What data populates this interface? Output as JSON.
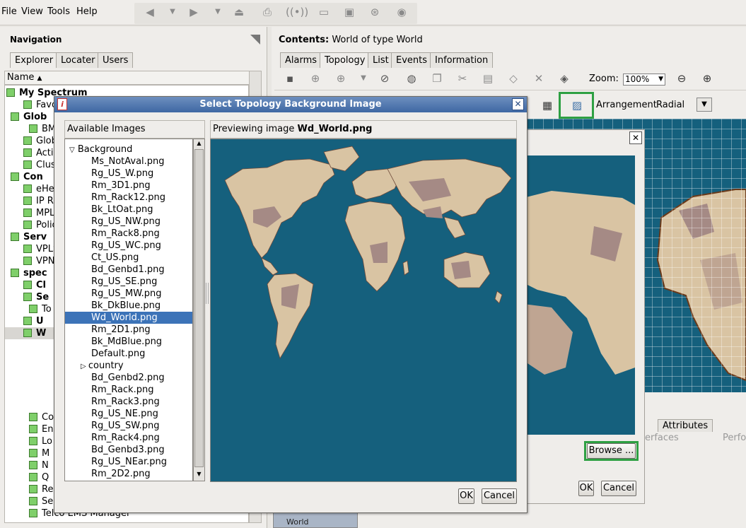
{
  "menubar": {
    "file": "File",
    "view": "View",
    "tools": "Tools",
    "help": "Help"
  },
  "nav": {
    "title": "Navigation",
    "tabs": [
      "Explorer",
      "Locater",
      "Users"
    ],
    "tree_header": "Name",
    "tree": [
      {
        "label": "My Spectrum",
        "bold": true
      },
      {
        "label": "Favo"
      },
      {
        "label": "Glob",
        "bold": true
      },
      {
        "label": "BM"
      },
      {
        "label": "Glob"
      },
      {
        "label": "Activ"
      },
      {
        "label": "Clust"
      },
      {
        "label": "Con",
        "bold": true
      },
      {
        "label": "eHea"
      },
      {
        "label": "IP Ro"
      },
      {
        "label": "MPLS"
      },
      {
        "label": "Polic"
      },
      {
        "label": "Serv",
        "bold": true
      },
      {
        "label": "VPLS"
      },
      {
        "label": "VPN"
      },
      {
        "label": "spec",
        "bold": true
      },
      {
        "label": "Cl",
        "bold": true
      },
      {
        "label": "Se",
        "bold": true
      },
      {
        "label": "To"
      },
      {
        "label": "U",
        "bold": true
      },
      {
        "label": "W",
        "bold": true
      },
      {
        "label": ""
      },
      {
        "label": ""
      },
      {
        "label": ""
      },
      {
        "label": ""
      },
      {
        "label": ""
      },
      {
        "label": ""
      },
      {
        "label": "Co"
      },
      {
        "label": "En"
      },
      {
        "label": "Lo"
      },
      {
        "label": "M"
      },
      {
        "label": "N"
      },
      {
        "label": "Q"
      },
      {
        "label": "Re"
      },
      {
        "label": "Se"
      },
      {
        "label": "Telco EMS Manager"
      }
    ]
  },
  "contents": {
    "prefix": "Contents:",
    "title": "World of type World"
  },
  "right_tabs": [
    "Alarms",
    "Topology",
    "List",
    "Events",
    "Information"
  ],
  "toolbar": {
    "zoom_label": "Zoom:",
    "zoom_value": "100%"
  },
  "arrangement": {
    "label": "Arrangement",
    "value": "Radial"
  },
  "bottom": {
    "attributes_tab": "Attributes",
    "interfaces_tab": "erfaces",
    "perf_tab": "Perfo",
    "world_label": "World"
  },
  "dlg2": {
    "browse": "Browse ...",
    "ok": "OK",
    "cancel": "Cancel"
  },
  "dialog": {
    "title": "Select Topology Background Image",
    "available_header": "Available Images",
    "preview_prefix": "Previewing image",
    "preview_file": "Wd_World.png",
    "folder_background": "Background",
    "images": [
      "Ms_NotAval.png",
      "Rg_US_W.png",
      "Rm_3D1.png",
      "Rm_Rack12.png",
      "Bk_LtOat.png",
      "Rg_US_NW.png",
      "Rm_Rack8.png",
      "Rg_US_WC.png",
      "Ct_US.png",
      "Bd_Genbd1.png",
      "Rg_US_SE.png",
      "Rg_US_MW.png",
      "Bk_DkBlue.png",
      "Wd_World.png",
      "Rm_2D1.png",
      "Bk_MdBlue.png",
      "Default.png"
    ],
    "folder_country": "country",
    "images2": [
      "Bd_Genbd2.png",
      "Rm_Rack.png",
      "Rm_Rack3.png",
      "Rg_US_NE.png",
      "Rg_US_SW.png",
      "Rm_Rack4.png",
      "Bd_Genbd3.png",
      "Rg_US_NEar.png",
      "Rm_2D2.png"
    ],
    "ok": "OK",
    "cancel": "Cancel"
  },
  "colors": {
    "ocean": "#15607d",
    "land": "#d9c4a3",
    "land_dark": "#a58a85",
    "title_bar": "#4a72ab",
    "selection": "#3c73b8",
    "highlight": "#2ea043"
  }
}
